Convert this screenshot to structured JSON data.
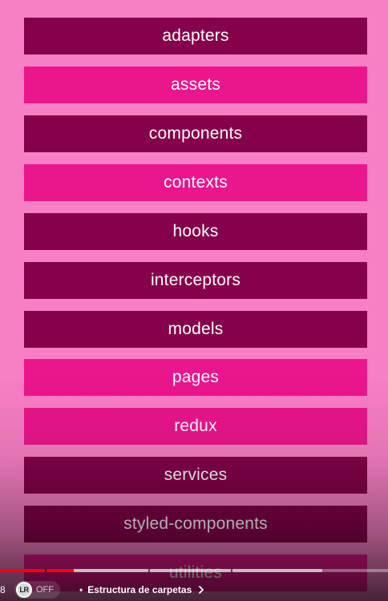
{
  "folders": [
    {
      "label": "adapters",
      "tone": "dark"
    },
    {
      "label": "assets",
      "tone": "bright"
    },
    {
      "label": "components",
      "tone": "dark"
    },
    {
      "label": "contexts",
      "tone": "bright"
    },
    {
      "label": "hooks",
      "tone": "dark"
    },
    {
      "label": "interceptors",
      "tone": "dark"
    },
    {
      "label": "models",
      "tone": "dark"
    },
    {
      "label": "pages",
      "tone": "bright"
    },
    {
      "label": "redux",
      "tone": "bright"
    },
    {
      "label": "services",
      "tone": "dark"
    },
    {
      "label": "styled-components",
      "tone": "dark"
    },
    {
      "label": "utilities",
      "tone": "bright"
    }
  ],
  "player": {
    "time_partial": "8",
    "played_fraction": 0.19,
    "buffered_fraction": 0.83,
    "extension_logo_text": "LR",
    "extension_state": "OFF",
    "chapter_bullet": "•",
    "chapter_title": "Estructura de carpetas",
    "colors": {
      "played": "#ff0000",
      "dark_folder": "#85014b",
      "bright_folder": "#eb158d",
      "background": "#f77fc4"
    }
  }
}
